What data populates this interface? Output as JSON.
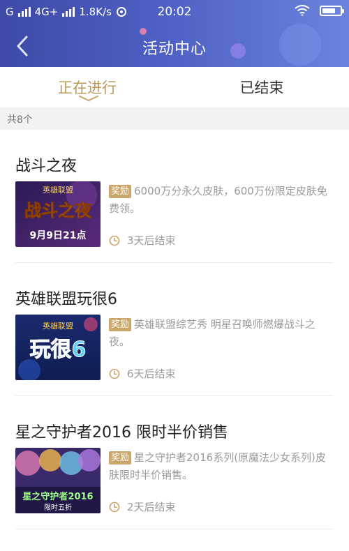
{
  "status_bar": {
    "carrier1": "G",
    "carrier2": "4G+",
    "speed": "1.8K/s",
    "time": "20:02",
    "battery_level": 0.6
  },
  "nav": {
    "title": "活动中心"
  },
  "tabs": [
    {
      "label": "正在进行",
      "active": true
    },
    {
      "label": "已结束",
      "active": false
    }
  ],
  "count_label": "共8个",
  "reward_badge": "奖励",
  "colors": {
    "header_start": "#3e4aa6",
    "header_end": "#6b84dc",
    "accent_gold": "#c9a66b",
    "active_tab": "#b8985a"
  },
  "events": [
    {
      "title": "战斗之夜",
      "thumb_text_top": "英雄联盟",
      "thumb_text_main": "战斗之夜",
      "thumb_text_date": "9月9日21点",
      "reward": "6000万分永久皮肤，600万份限定皮肤免费领。",
      "deadline": "3天后结束"
    },
    {
      "title": "英雄联盟玩很6",
      "thumb_text_top": "英雄联盟",
      "thumb_text_main": "玩很6",
      "reward": "英雄联盟综艺秀 明星召唤师燃爆战斗之夜。",
      "deadline": "6天后结束"
    },
    {
      "title": "星之守护者2016 限时半价销售",
      "thumb_text_main": "星之守护者2016",
      "thumb_text_sub": "限时五折",
      "reward": "星之守护者2016系列(原魔法少女系列)皮肤限时半价销售。",
      "deadline": "2天后结束"
    }
  ]
}
